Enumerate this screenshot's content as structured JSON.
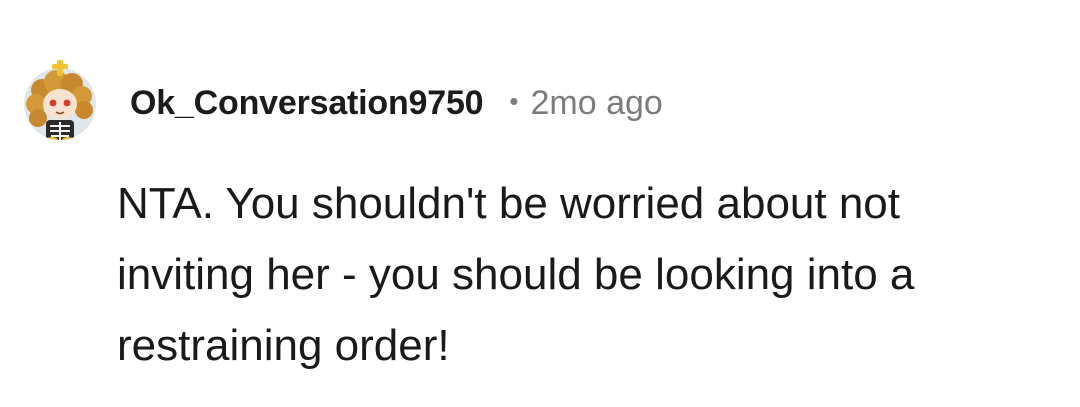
{
  "comment": {
    "author": "Ok_Conversation9750",
    "separator": "•",
    "timestamp": "2mo ago",
    "body": "NTA. You shouldn't be worried about not inviting her - you should be looking into a restraining order!",
    "avatar_icon": "user-avatar-icon",
    "colors": {
      "author": "#1c1c1c",
      "meta": "#7c7c7c",
      "body": "#1a1a1a"
    }
  }
}
